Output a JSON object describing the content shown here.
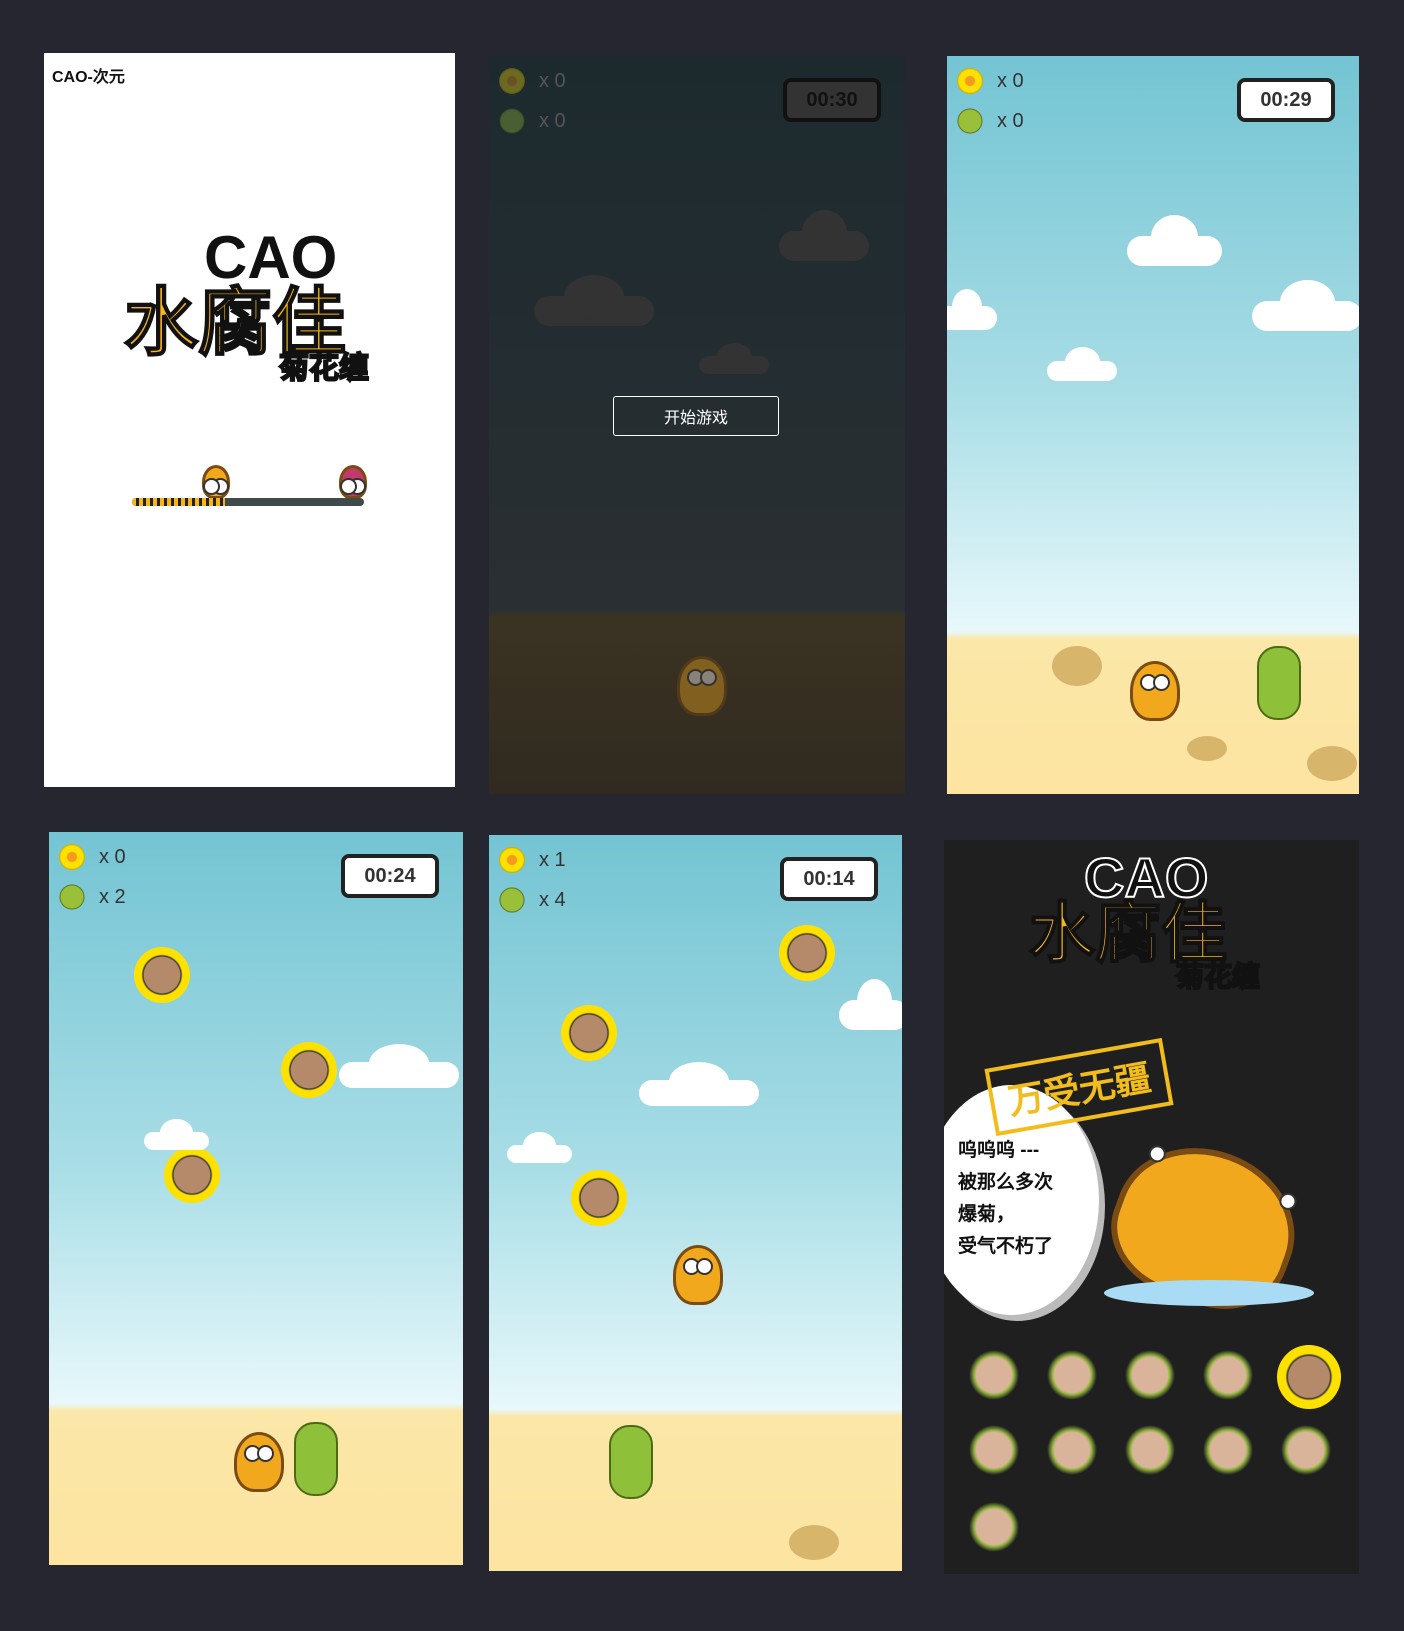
{
  "screen1": {
    "brand": "CAO-次元",
    "logo_main": "水腐佳",
    "logo_cao": "CAO",
    "logo_sub": "菊花缠",
    "loading_progress": 0.4
  },
  "screen2": {
    "flower_count": "x 0",
    "cactus_count": "x 0",
    "timer": "00:30",
    "start_button": "开始游戏"
  },
  "screen3": {
    "flower_count": "x 0",
    "cactus_count": "x 0",
    "timer": "00:29"
  },
  "screen4": {
    "flower_count": "x 0",
    "cactus_count": "x 2",
    "timer": "00:24"
  },
  "screen5": {
    "flower_count": "x 1",
    "cactus_count": "x 4",
    "timer": "00:14"
  },
  "screen6": {
    "logo_main": "水腐佳",
    "logo_cao": "CAO",
    "logo_sub": "菊花缠",
    "stamp": "万受无疆",
    "bubble_lines": [
      "呜呜呜 ---",
      "被那么多次",
      "爆菊，",
      "受气不朽了"
    ]
  },
  "colors": {
    "accent": "#f7b51c",
    "sky": "#74c4d3",
    "sand": "#fde4a1",
    "bg": "#262630"
  }
}
